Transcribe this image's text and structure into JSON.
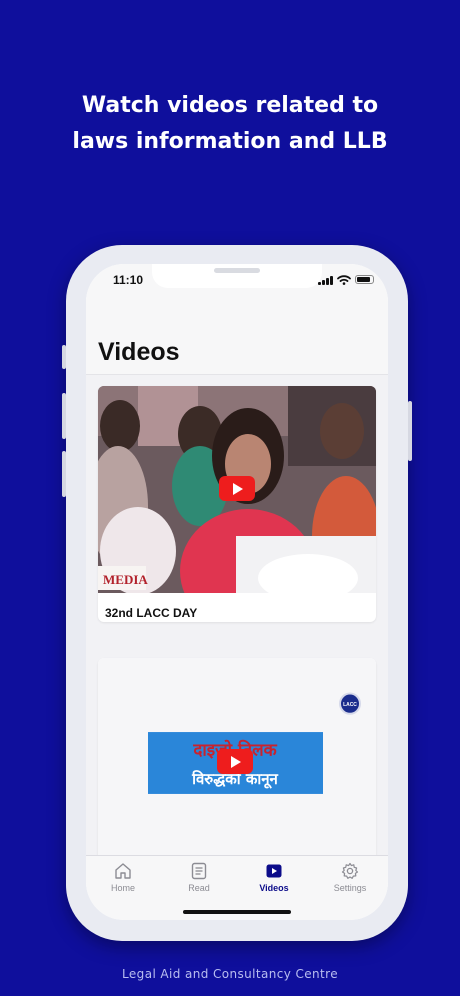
{
  "headline": "Watch videos related to laws information and LLB",
  "footer": "Legal Aid and Consultancy Centre",
  "status_bar": {
    "time": "11:10"
  },
  "page_title": "Videos",
  "videos": [
    {
      "title": "32nd LACC DAY",
      "watermark": "MEDIA",
      "icon": "youtube-play-icon"
    },
    {
      "title": "",
      "banner_line1": "दाइजो तिलक",
      "banner_line2": "विरुद्धको कानून",
      "badge": "LACC",
      "icon": "youtube-play-icon"
    }
  ],
  "tabs": [
    {
      "label": "Home",
      "icon": "home-icon",
      "active": false
    },
    {
      "label": "Read",
      "icon": "document-icon",
      "active": false
    },
    {
      "label": "Videos",
      "icon": "video-icon",
      "active": true
    },
    {
      "label": "Settings",
      "icon": "gear-icon",
      "active": false
    }
  ],
  "colors": {
    "background": "#0f0f9c",
    "accent": "#0c0c8a",
    "youtube_red": "#ee1d1d"
  }
}
